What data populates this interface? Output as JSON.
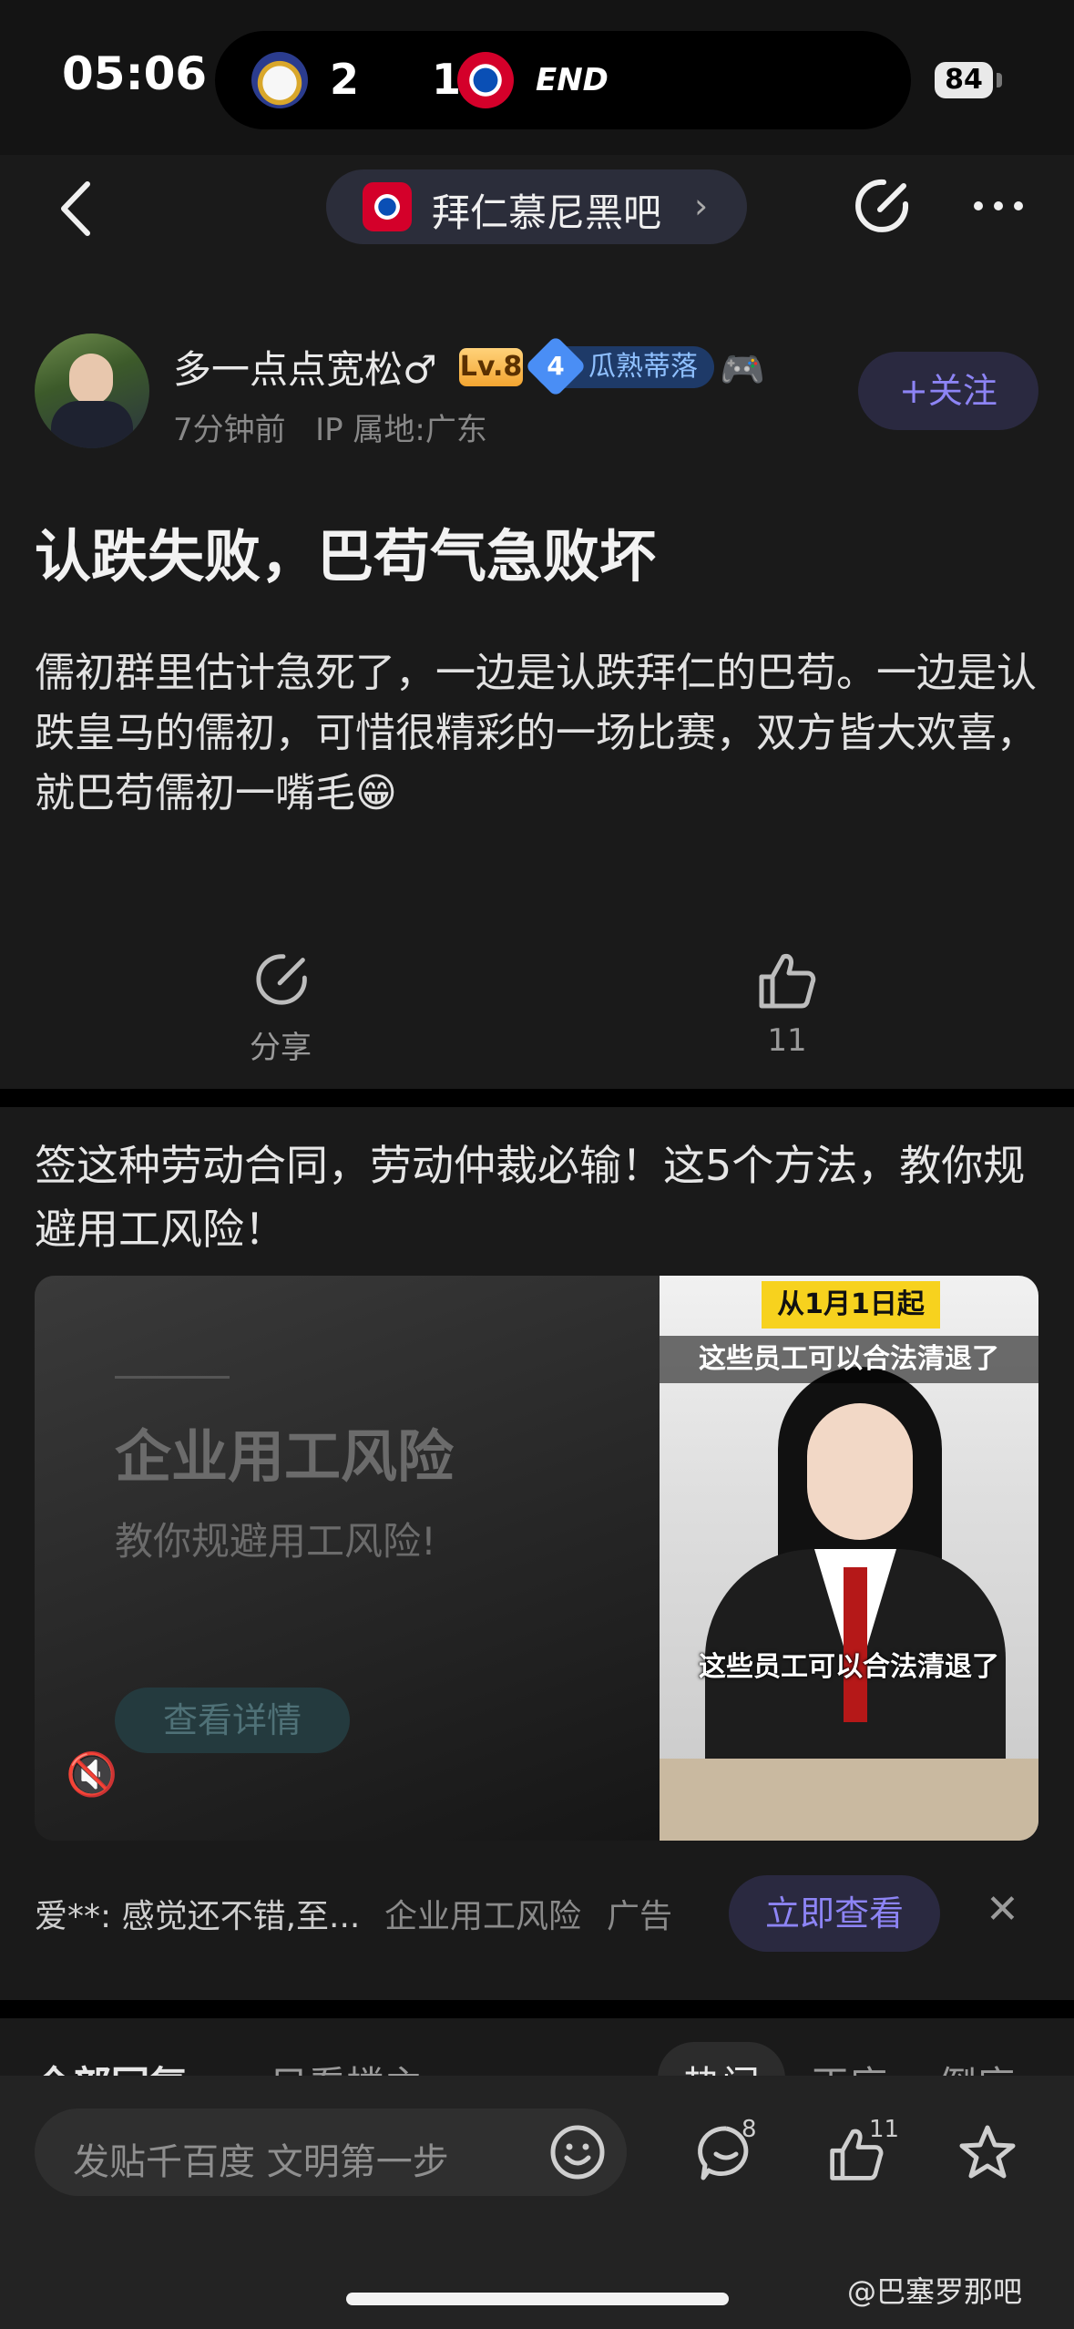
{
  "status": {
    "time": "05:06",
    "home_score": "2",
    "away_score": "1",
    "match_state": "END",
    "battery": "84"
  },
  "nav": {
    "forum_name": "拜仁慕尼黑吧"
  },
  "post": {
    "username": "多一点点宽松♂",
    "level": "Lv.8",
    "badge_number": "4",
    "badge_text": "瓜熟蒂落",
    "time_ago": "7分钟前",
    "ip_location": "IP 属地:广东",
    "follow_label": "+关注",
    "title": "认跌失败，巴苟气急败坏",
    "body": "儒初群里估计急死了，一边是认跌拜仁的巴苟。一边是认跌皇马的儒初，可惜很精彩的一场比赛，双方皆大欢喜，就巴苟儒初一嘴毛😁",
    "share_label": "分享",
    "like_count": "11"
  },
  "ad": {
    "title": "签这种劳动合同，劳动仲裁必输！这5个方法，教你规避用工风险！",
    "media_heading": "企业用工风险",
    "media_subheading": "教你规避用工风险!",
    "media_button": "查看详情",
    "video_tag": "从1月1日起",
    "video_caption_top": "这些员工可以合法清退了",
    "video_caption_bottom": "这些员工可以合法清退了",
    "review_text": "爱**: 感觉还不错,至...",
    "advertiser": "企业用工风险",
    "ad_label": "广告",
    "cta_label": "立即查看"
  },
  "comments_header": {
    "all_replies": "全部回复",
    "op_only": "只看楼主",
    "sort_hot": "热门",
    "sort_asc": "正序",
    "sort_desc": "倒序"
  },
  "bottom": {
    "compose_placeholder": "发贴千百度 文明第一步",
    "comment_count": "8",
    "like_count": "11"
  },
  "watermark": "@巴塞罗那吧"
}
